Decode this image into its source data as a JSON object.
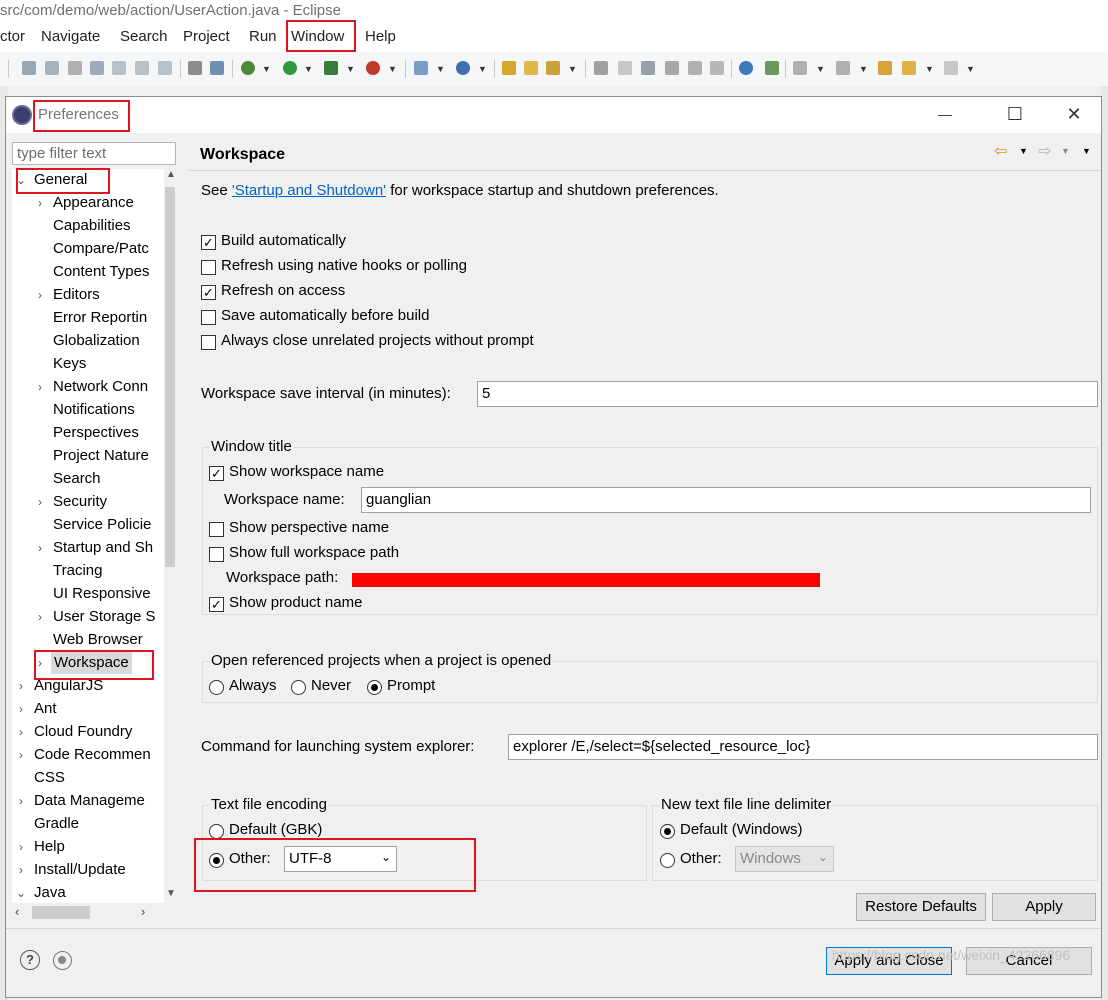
{
  "eclipse": {
    "title": "src/com/demo/web/action/UserAction.java - Eclipse",
    "menu": [
      "ctor",
      "Navigate",
      "Search",
      "Project",
      "Run",
      "Window",
      "Help"
    ]
  },
  "dialog": {
    "title": "Preferences",
    "filter_placeholder": "type filter text",
    "page_title": "Workspace"
  },
  "tree": [
    {
      "label": "General",
      "arrow": "⌄",
      "level": 0
    },
    {
      "label": "Appearance",
      "arrow": "›",
      "level": 1
    },
    {
      "label": "Capabilities",
      "arrow": "",
      "level": 1
    },
    {
      "label": "Compare/Patc",
      "arrow": "",
      "level": 1
    },
    {
      "label": "Content Types",
      "arrow": "",
      "level": 1
    },
    {
      "label": "Editors",
      "arrow": "›",
      "level": 1
    },
    {
      "label": "Error Reportin",
      "arrow": "",
      "level": 1
    },
    {
      "label": "Globalization",
      "arrow": "",
      "level": 1
    },
    {
      "label": "Keys",
      "arrow": "",
      "level": 1
    },
    {
      "label": "Network Conn",
      "arrow": "›",
      "level": 1
    },
    {
      "label": "Notifications",
      "arrow": "",
      "level": 1
    },
    {
      "label": "Perspectives",
      "arrow": "",
      "level": 1
    },
    {
      "label": "Project Nature",
      "arrow": "",
      "level": 1
    },
    {
      "label": "Search",
      "arrow": "",
      "level": 1
    },
    {
      "label": "Security",
      "arrow": "›",
      "level": 1
    },
    {
      "label": "Service Policie",
      "arrow": "",
      "level": 1
    },
    {
      "label": "Startup and Sh",
      "arrow": "›",
      "level": 1
    },
    {
      "label": "Tracing",
      "arrow": "",
      "level": 1
    },
    {
      "label": "UI Responsive",
      "arrow": "",
      "level": 1
    },
    {
      "label": "User Storage S",
      "arrow": "›",
      "level": 1
    },
    {
      "label": "Web Browser",
      "arrow": "",
      "level": 1
    },
    {
      "label": "Workspace",
      "arrow": "›",
      "level": 1
    },
    {
      "label": "AngularJS",
      "arrow": "›",
      "level": 0
    },
    {
      "label": "Ant",
      "arrow": "›",
      "level": 0
    },
    {
      "label": "Cloud Foundry",
      "arrow": "›",
      "level": 0
    },
    {
      "label": "Code Recommen",
      "arrow": "›",
      "level": 0
    },
    {
      "label": "CSS",
      "arrow": "",
      "level": 0
    },
    {
      "label": "Data Manageme",
      "arrow": "›",
      "level": 0
    },
    {
      "label": "Gradle",
      "arrow": "",
      "level": 0
    },
    {
      "label": "Help",
      "arrow": "›",
      "level": 0
    },
    {
      "label": "Install/Update",
      "arrow": "›",
      "level": 0
    },
    {
      "label": "Java",
      "arrow": "⌄",
      "level": 0
    }
  ],
  "page": {
    "intro_before": "See ",
    "intro_link": "'Startup and Shutdown'",
    "intro_after": " for workspace startup and shutdown preferences.",
    "checks": [
      {
        "label": "Build automatically",
        "checked": true
      },
      {
        "label": "Refresh using native hooks or polling",
        "checked": false
      },
      {
        "label": "Refresh on access",
        "checked": true
      },
      {
        "label": "Save automatically before build",
        "checked": false
      },
      {
        "label": "Always close unrelated projects without prompt",
        "checked": false
      }
    ],
    "save_interval_label": "Workspace save interval (in minutes):",
    "save_interval_value": "5",
    "window_title_group": "Window title",
    "show_workspace_name": "Show workspace name",
    "workspace_name_label": "Workspace name:",
    "workspace_name_value": "guanglian",
    "show_perspective_name": "Show perspective name",
    "show_full_path": "Show full workspace path",
    "workspace_path_label": "Workspace path:",
    "show_product_name": "Show product name",
    "open_ref_group": "Open referenced projects when a project is opened",
    "open_ref_options": [
      "Always",
      "Never",
      "Prompt"
    ],
    "open_ref_selected": "Prompt",
    "explorer_label": "Command for launching system explorer:",
    "explorer_value": "explorer /E,/select=${selected_resource_loc}",
    "encoding_group": "Text file encoding",
    "encoding_default": "Default (GBK)",
    "encoding_other": "Other:",
    "encoding_value": "UTF-8",
    "delimiter_group": "New text file line delimiter",
    "delimiter_default": "Default (Windows)",
    "delimiter_other": "Other:",
    "delimiter_value": "Windows"
  },
  "buttons": {
    "restore_defaults": "Restore Defaults",
    "apply": "Apply",
    "apply_and_close": "Apply and Close",
    "cancel": "Cancel"
  },
  "watermark": "https://blog.csdn.net/weixin_42266896",
  "colors": {
    "highlight_red": "#e0141e",
    "link": "#0563c1",
    "redaction": "#ff0000"
  }
}
